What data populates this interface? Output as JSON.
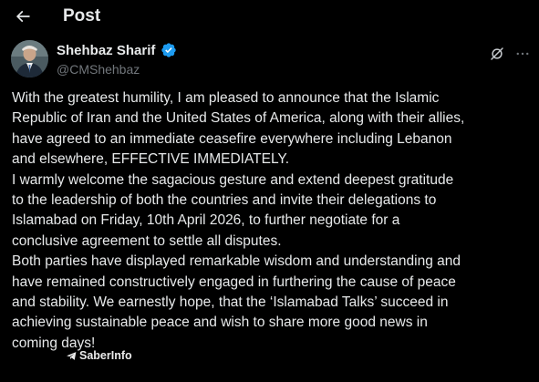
{
  "header": {
    "title": "Post",
    "back_icon": "arrow-left-icon"
  },
  "author": {
    "name": "Shehbaz Sharif",
    "handle": "@CMShehbaz",
    "verified_icon": "verified-badge-icon",
    "verified_color": "#1d9bf0"
  },
  "actions": {
    "grok_icon": "grok-icon",
    "more_icon": "more-horizontal-icon"
  },
  "post": {
    "paragraphs": [
      "With the greatest humility, I am pleased to announce that the Islamic\nRepublic of Iran and the United States of America, along with their allies,\nhave agreed to an immediate ceasefire everywhere including Lebanon\nand elsewhere, EFFECTIVE IMMEDIATELY.",
      "I warmly welcome the sagacious gesture and extend deepest gratitude\nto the leadership of both the countries and invite their delegations to\nIslamabad on Friday, 10th April 2026, to further negotiate for a\nconclusive agreement to settle all disputes.",
      "Both parties have displayed remarkable wisdom and understanding and\nhave remained constructively engaged in furthering the cause of peace\nand stability. We earnestly hope, that the ‘Islamabad Talks’ succeed in\nachieving sustainable peace and wish to share more good news in\ncoming days!"
    ]
  },
  "watermark": {
    "text": "SaberInfo",
    "icon": "telegram-icon"
  },
  "colors": {
    "background": "#000000",
    "text": "#e7e9ea",
    "secondary_text": "#71767b",
    "accent": "#1d9bf0"
  }
}
